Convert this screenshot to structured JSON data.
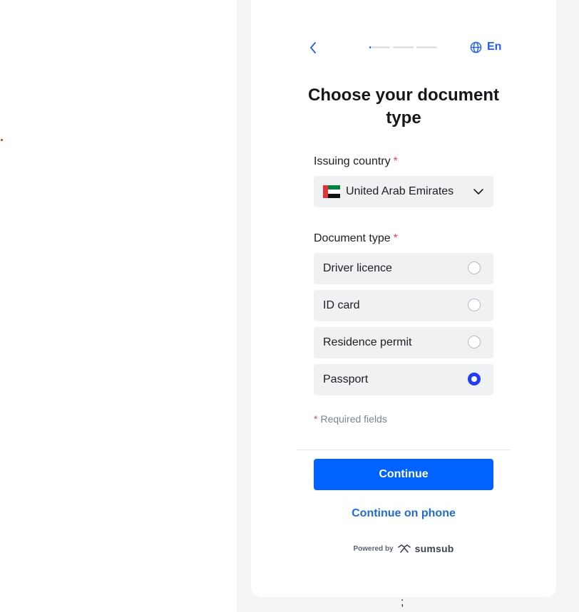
{
  "header": {
    "language_label": "En",
    "progress": {
      "steps": 3,
      "current_step": 1,
      "current_step_fill": 0.07
    }
  },
  "title": "Choose your document type",
  "issuing_country": {
    "label": "Issuing country",
    "required_mark": "*",
    "selected": "United Arab Emirates",
    "flag_colors": {
      "hoist": "#e53238",
      "top": "#00843d",
      "middle": "#ffffff",
      "bottom": "#111111"
    }
  },
  "document_type": {
    "label": "Document type",
    "required_mark": "*",
    "options": [
      {
        "label": "Driver licence",
        "selected": false
      },
      {
        "label": "ID card",
        "selected": false
      },
      {
        "label": "Residence permit",
        "selected": false
      },
      {
        "label": "Passport",
        "selected": true
      }
    ]
  },
  "required_note": {
    "mark": "*",
    "text": "Required fields"
  },
  "continue_label": "Continue",
  "continue_on_phone_label": "Continue on phone",
  "footer": {
    "powered_by": "Powered by",
    "brand": "sumsub"
  },
  "stray_text": ";",
  "colors": {
    "accent": "#0063ff",
    "link": "#1f6bdb",
    "required": "#e5484d",
    "radio_checked": "#1f3bff"
  }
}
